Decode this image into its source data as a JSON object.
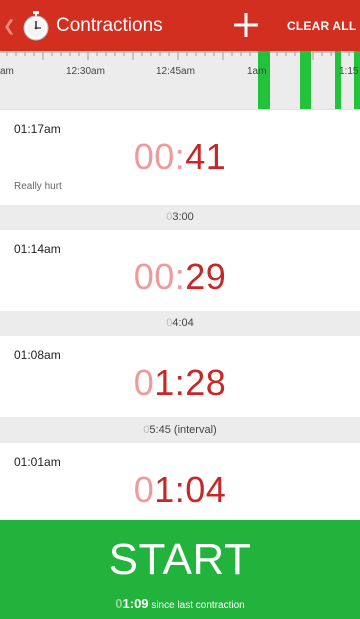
{
  "header": {
    "back_glyph": "❮",
    "app_icon": "stopwatch-icon",
    "title": "Contractions",
    "add_icon": "plus-icon",
    "clear_all_label": "CLEAR ALL"
  },
  "timeline": {
    "labels": [
      "am",
      "12:30am",
      "12:45am",
      "1am",
      "1:15"
    ]
  },
  "contractions": [
    {
      "start_time": "01:17am",
      "duration_dim": "00:",
      "duration_main": "41",
      "note": "Really hurt"
    },
    {
      "start_time": "01:14am",
      "duration_dim": "00:",
      "duration_main": "29",
      "note": ""
    },
    {
      "start_time": "01:08am",
      "duration_dim": "0",
      "duration_main": "1:28",
      "note": ""
    },
    {
      "start_time": "01:01am",
      "duration_dim": "0",
      "duration_main": "1:04",
      "note": ""
    }
  ],
  "gaps": [
    {
      "dim": "0",
      "main": "3:00",
      "suffix": ""
    },
    {
      "dim": "0",
      "main": "4:04",
      "suffix": ""
    },
    {
      "dim": "0",
      "main": "5:45",
      "suffix": " (interval)"
    }
  ],
  "start": {
    "label": "START",
    "since_dim": "0",
    "since_value": "1:09",
    "since_text": " since last contraction"
  },
  "colors": {
    "header_red": "#d32f20",
    "duration_red": "#c62828",
    "duration_dim": "#ef9a9a",
    "start_green": "#22b33d",
    "timeline_bar_green": "#22c33a"
  }
}
